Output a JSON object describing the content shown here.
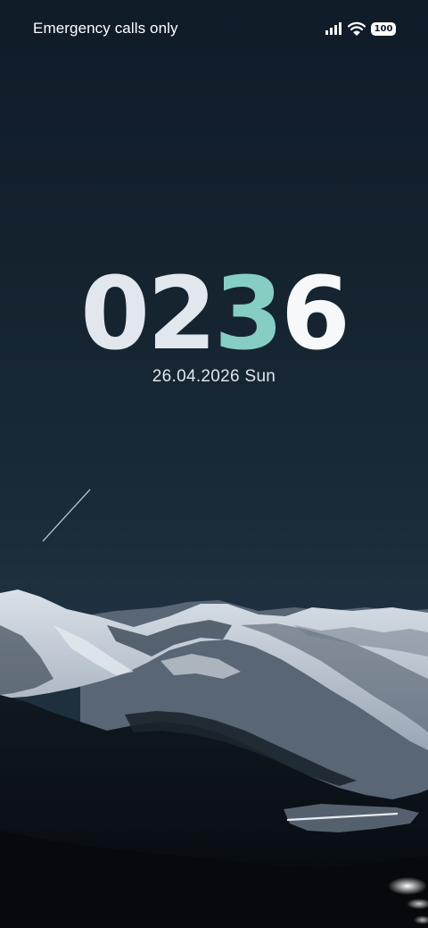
{
  "status_bar": {
    "carrier_text": "Emergency calls only",
    "battery_level": "100",
    "icons": [
      "signal-icon",
      "wifi-icon",
      "battery-icon"
    ]
  },
  "lock_screen": {
    "time": {
      "digit_1": "0",
      "digit_2": "2",
      "digit_3": "3",
      "digit_4": "6"
    },
    "date": "26.04.2026 Sun"
  },
  "colors": {
    "accent_digit": "#86cdc4",
    "digit": "#e2e7ee",
    "sky": "#15232f"
  }
}
